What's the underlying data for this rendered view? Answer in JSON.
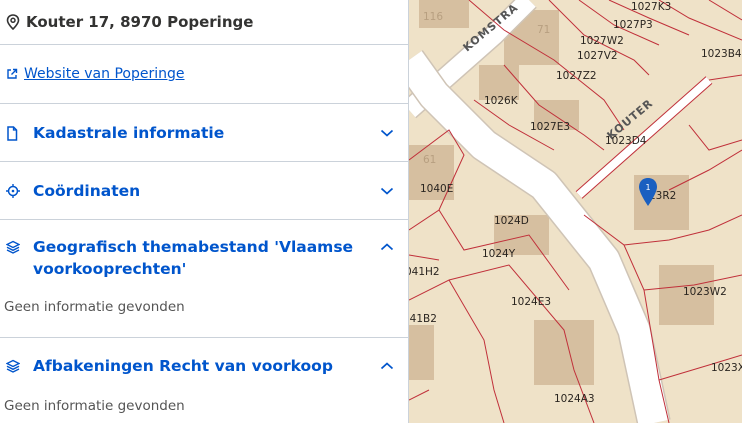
{
  "panel": {
    "address": "Kouter 17, 8970 Poperinge",
    "website_link": "Website van Poperinge",
    "sections": [
      {
        "title": "Kadastrale informatie",
        "icon": "document-icon",
        "expanded": false
      },
      {
        "title": "Coördinaten",
        "icon": "crosshair-icon",
        "expanded": false
      },
      {
        "title": "Geografisch themabestand 'Vlaamse voorkooprechten'",
        "icon": "layers-icon",
        "expanded": true,
        "body": "Geen informatie gevonden"
      },
      {
        "title": "Afbakeningen Recht van voorkoop",
        "icon": "layers-icon",
        "expanded": true,
        "body": "Geen informatie gevonden"
      }
    ]
  },
  "map": {
    "streets": [
      "KOMSTRA",
      "KOUTER"
    ],
    "parcels": [
      "1027K3",
      "1027P3",
      "1027W2",
      "1027V2",
      "1023B4",
      "1027Z2",
      "1026K",
      "1027E3",
      "1023D4",
      "1040E",
      "23R2",
      "1024D",
      "1024Y",
      "041H2",
      "1024E3",
      "1023W2",
      "041B2",
      "1023X",
      "1024A3",
      "116",
      "61",
      "71"
    ],
    "marker_number": "1",
    "colors": {
      "parcel_line": "#c0303a",
      "building": "#d6bfa0",
      "road": "#ffffff",
      "ground": "#efe2c8",
      "marker": "#1a5fc0"
    }
  }
}
